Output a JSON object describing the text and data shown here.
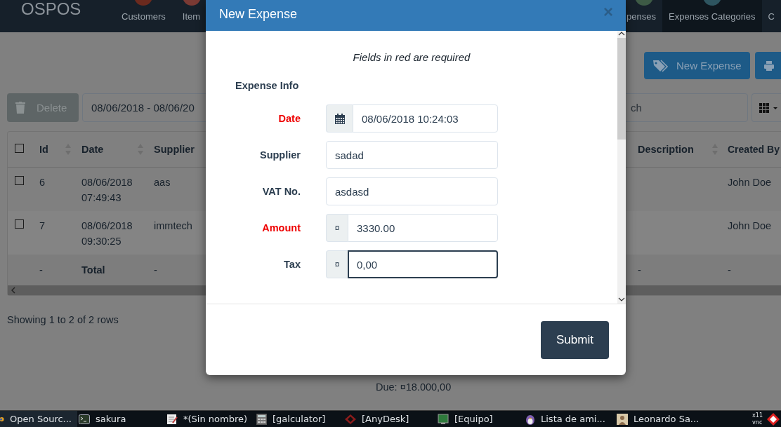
{
  "navbar": {
    "logo": "OSPOS",
    "left_items": [
      {
        "label": "Customers",
        "kind": "customers",
        "selected": false
      },
      {
        "label": "Item",
        "kind": "items",
        "selected": false
      }
    ],
    "right_items": [
      {
        "label": "penses",
        "kind": "expenses",
        "selected": false
      },
      {
        "label": "Expenses Categories",
        "kind": "categories",
        "selected": true
      },
      {
        "label": "C",
        "kind": "plain",
        "selected": false
      }
    ]
  },
  "toolbar": {
    "new_button": "New Expense",
    "delete_button": {
      "label": "Delete",
      "disabled": true
    },
    "date_range": "08/06/2018 - 08/06/20",
    "search_placeholder": "ch"
  },
  "table": {
    "header_checked": false,
    "columns": [
      {
        "label": "Id",
        "sortable": true
      },
      {
        "label": "Date",
        "sortable": true
      },
      {
        "label": "Supplier",
        "sortable": false
      },
      {
        "label": "Description",
        "sortable": true
      },
      {
        "label": "Created By",
        "sortable": false
      }
    ],
    "rows": [
      {
        "checked": false,
        "id": "6",
        "date": "08/06/2018 07:49:43",
        "supplier": "aas",
        "created_by": "John Doe"
      },
      {
        "checked": false,
        "id": "7",
        "date": "08/06/2018 09:30:25",
        "supplier": "immtech",
        "created_by": "John Doe"
      }
    ],
    "footer": {
      "id": "-",
      "date": "Total",
      "supplier": "-",
      "description": "-",
      "created_by": "-"
    }
  },
  "pagination": "Showing 1 to 2 of 2 rows",
  "due": "Due: ¤18.000,00",
  "modal": {
    "title": "New Expense",
    "close": "×",
    "note": "Fields in red are required",
    "section": "Expense Info",
    "fields": [
      {
        "kind": "date",
        "label": "Date",
        "required": true,
        "value": "08/06/2018 10:24:03",
        "focused": false
      },
      {
        "kind": "text",
        "label": "Supplier",
        "required": false,
        "value": "sadad",
        "focused": false
      },
      {
        "kind": "text",
        "label": "VAT No.",
        "required": false,
        "value": "asdasd",
        "focused": false
      },
      {
        "kind": "currency",
        "label": "Amount",
        "required": true,
        "addon": "¤",
        "value": "3330.00",
        "focused": false
      },
      {
        "kind": "currency",
        "label": "Tax",
        "required": false,
        "addon": "¤",
        "value": "0,00",
        "focused": true
      }
    ],
    "submit": "Submit"
  },
  "taskbar": {
    "items": [
      {
        "label": "Open Sourc...",
        "kind": "browser",
        "selected": true
      },
      {
        "label": "sakura",
        "kind": "terminal",
        "selected": false
      },
      {
        "label": "*(Sin nombre)",
        "kind": "notepad",
        "selected": false
      },
      {
        "label": "[galculator]",
        "kind": "calculator",
        "selected": false
      },
      {
        "label": "[AnyDesk]",
        "kind": "diamond",
        "selected": false
      },
      {
        "label": "[Equipo]",
        "kind": "monitor",
        "selected": false
      },
      {
        "label": "Lista de ami...",
        "kind": "chat",
        "selected": false
      },
      {
        "label": "Leonardo Sa...",
        "kind": "avatar",
        "selected": false
      }
    ],
    "tray_top": "x11",
    "tray_bottom": "vnc"
  }
}
